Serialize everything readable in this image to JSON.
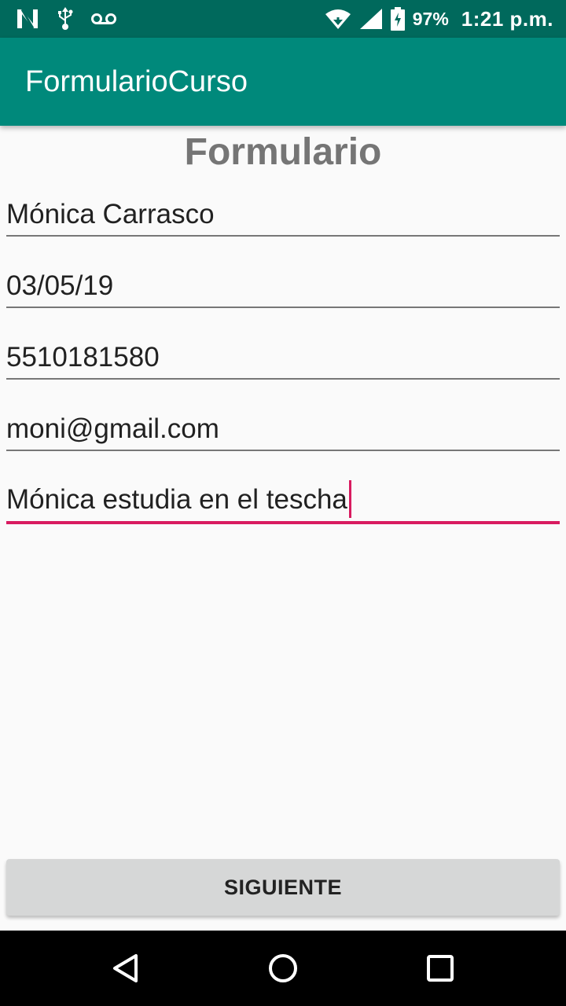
{
  "status_bar": {
    "icons_left": [
      "n-icon",
      "usb-icon",
      "voicemail-icon"
    ],
    "icons_right": [
      "wifi-icon",
      "signal-icon",
      "battery-charging-icon"
    ],
    "battery_percent": "97%",
    "time": "1:21 p.m.",
    "background": "#00695c"
  },
  "app_bar": {
    "title": "FormularioCurso",
    "background": "#00897b"
  },
  "form": {
    "heading": "Formulario",
    "fields": [
      {
        "value": "Mónica Carrasco"
      },
      {
        "value": "03/05/19"
      },
      {
        "value": "5510181580"
      },
      {
        "value": "moni@gmail.com"
      },
      {
        "value": "Mónica estudia en el tescha",
        "focused": true
      }
    ],
    "accent_color": "#d81b60"
  },
  "button": {
    "label": "SIGUIENTE"
  },
  "nav_bar": {
    "buttons": [
      "back-icon",
      "home-icon",
      "recents-icon"
    ]
  }
}
